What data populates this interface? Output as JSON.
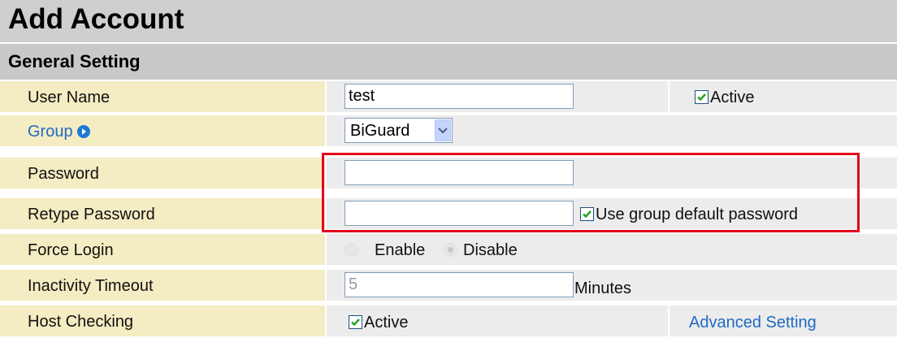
{
  "page_title": "Add Account",
  "section_title": "General Setting",
  "rows": {
    "user_name": {
      "label": "User Name",
      "value": "test",
      "active_label": "Active",
      "active_checked": true
    },
    "group": {
      "label": "Group",
      "selected": "BiGuard"
    },
    "password": {
      "label": "Password",
      "value": ""
    },
    "retype_password": {
      "label": "Retype Password",
      "value": "",
      "default_label": "Use group default password",
      "default_checked": true
    },
    "force_login": {
      "label": "Force Login",
      "option_enable": "Enable",
      "option_disable": "Disable"
    },
    "inactivity_timeout": {
      "label": "Inactivity Timeout",
      "value": "5",
      "unit": "Minutes"
    },
    "host_checking": {
      "label": "Host Checking",
      "active_label": "Active",
      "active_checked": true,
      "advanced_link": "Advanced Setting"
    }
  },
  "colors": {
    "label_bg": "#f4ecc2",
    "field_bg": "#ececec",
    "header_bg": "#cfcfcf",
    "link": "#1f6bc4",
    "highlight": "#e2001a"
  },
  "icons": {
    "group_arrow": "chevron-right-circle-icon",
    "check": "checkmark-icon",
    "dropdown": "chevron-down-icon"
  }
}
